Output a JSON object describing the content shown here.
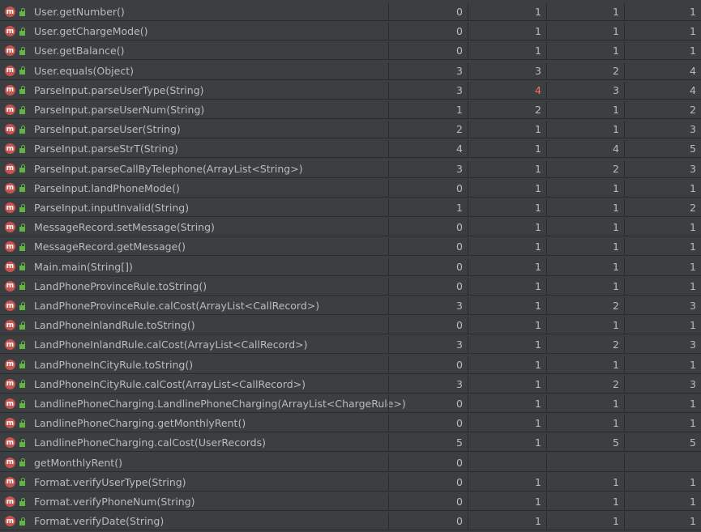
{
  "rows": [
    {
      "name": "User.getNumber()",
      "v": [
        "0",
        "1",
        "1",
        "1"
      ]
    },
    {
      "name": "User.getChargeMode()",
      "v": [
        "0",
        "1",
        "1",
        "1"
      ]
    },
    {
      "name": "User.getBalance()",
      "v": [
        "0",
        "1",
        "1",
        "1"
      ]
    },
    {
      "name": "User.equals(Object)",
      "v": [
        "3",
        "3",
        "2",
        "4"
      ]
    },
    {
      "name": "ParseInput.parseUserType(String)",
      "v": [
        "3",
        "4",
        "3",
        "4"
      ]
    },
    {
      "name": "ParseInput.parseUserNum(String)",
      "v": [
        "1",
        "2",
        "1",
        "2"
      ]
    },
    {
      "name": "ParseInput.parseUser(String)",
      "v": [
        "2",
        "1",
        "1",
        "3"
      ]
    },
    {
      "name": "ParseInput.parseStrT(String)",
      "v": [
        "4",
        "1",
        "4",
        "5"
      ]
    },
    {
      "name": "ParseInput.parseCallByTelephone(ArrayList<String>)",
      "v": [
        "3",
        "1",
        "2",
        "3"
      ]
    },
    {
      "name": "ParseInput.landPhoneMode()",
      "v": [
        "0",
        "1",
        "1",
        "1"
      ]
    },
    {
      "name": "ParseInput.inputInvalid(String)",
      "v": [
        "1",
        "1",
        "1",
        "2"
      ]
    },
    {
      "name": "MessageRecord.setMessage(String)",
      "v": [
        "0",
        "1",
        "1",
        "1"
      ]
    },
    {
      "name": "MessageRecord.getMessage()",
      "v": [
        "0",
        "1",
        "1",
        "1"
      ]
    },
    {
      "name": "Main.main(String[])",
      "v": [
        "0",
        "1",
        "1",
        "1"
      ]
    },
    {
      "name": "LandPhoneProvinceRule.toString()",
      "v": [
        "0",
        "1",
        "1",
        "1"
      ]
    },
    {
      "name": "LandPhoneProvinceRule.calCost(ArrayList<CallRecord>)",
      "v": [
        "3",
        "1",
        "2",
        "3"
      ]
    },
    {
      "name": "LandPhoneInlandRule.toString()",
      "v": [
        "0",
        "1",
        "1",
        "1"
      ]
    },
    {
      "name": "LandPhoneInlandRule.calCost(ArrayList<CallRecord>)",
      "v": [
        "3",
        "1",
        "2",
        "3"
      ]
    },
    {
      "name": "LandPhoneInCityRule.toString()",
      "v": [
        "0",
        "1",
        "1",
        "1"
      ]
    },
    {
      "name": "LandPhoneInCityRule.calCost(ArrayList<CallRecord>)",
      "v": [
        "3",
        "1",
        "2",
        "3"
      ]
    },
    {
      "name": "LandlinePhoneCharging.LandlinePhoneCharging(ArrayList<ChargeRule>)",
      "v": [
        "0",
        "1",
        "1",
        "1"
      ]
    },
    {
      "name": "LandlinePhoneCharging.getMonthlyRent()",
      "v": [
        "0",
        "1",
        "1",
        "1"
      ]
    },
    {
      "name": "LandlinePhoneCharging.calCost(UserRecords)",
      "v": [
        "5",
        "1",
        "5",
        "5"
      ]
    },
    {
      "name": "getMonthlyRent()",
      "v": [
        "0",
        "",
        "",
        ""
      ]
    },
    {
      "name": "Format.verifyUserType(String)",
      "v": [
        "0",
        "1",
        "1",
        "1"
      ]
    },
    {
      "name": "Format.verifyPhoneNum(String)",
      "v": [
        "0",
        "1",
        "1",
        "1"
      ]
    },
    {
      "name": "Format.verifyDate(String)",
      "v": [
        "0",
        "1",
        "1",
        "1"
      ]
    }
  ],
  "icons": {
    "method": "method-icon",
    "access": "public-lock-icon"
  },
  "colors": {
    "highlight": "#ff6b68",
    "method_icon": "#c75450",
    "lock": "#62b543"
  },
  "highlight": {
    "row": 4,
    "col": 1
  },
  "icon_letter": "m"
}
